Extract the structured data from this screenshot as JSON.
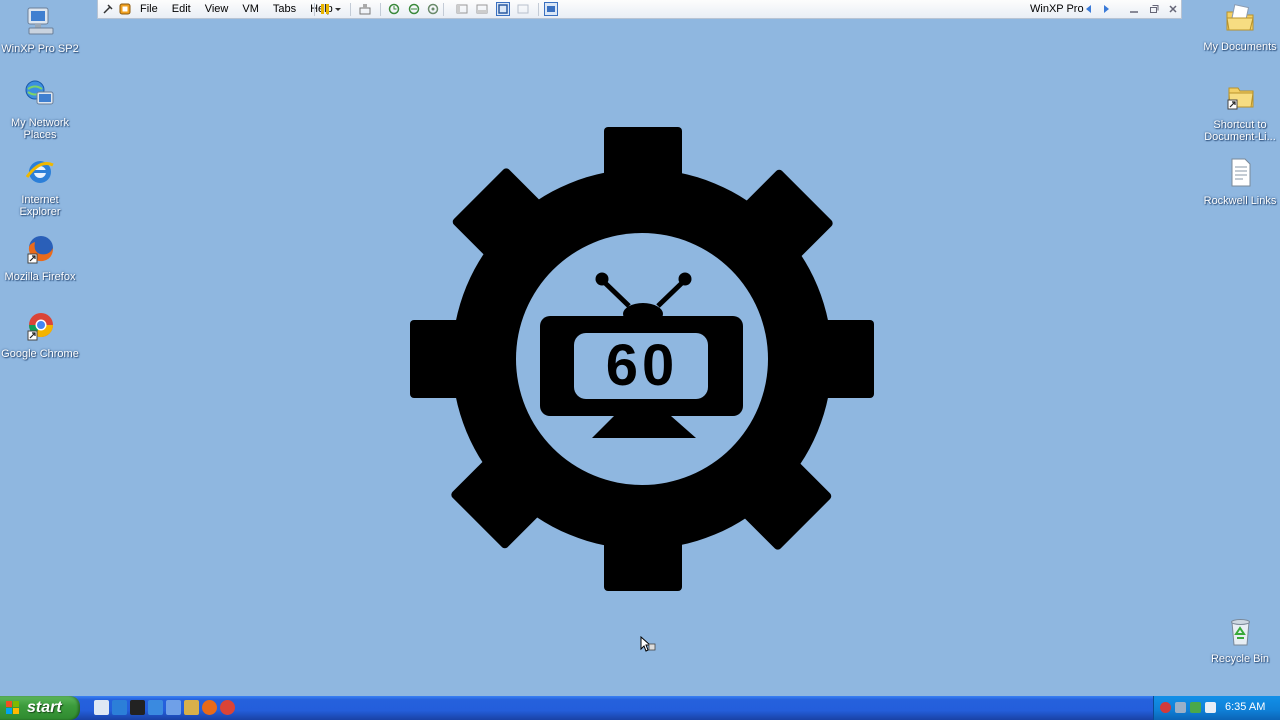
{
  "vm_toolbar": {
    "menu": [
      "File",
      "Edit",
      "View",
      "VM",
      "Tabs",
      "Help"
    ],
    "vm_name": "WinXP Pro"
  },
  "desktop": {
    "left_icons": [
      {
        "label": "WinXP Pro SP2",
        "icon": "computer-icon"
      },
      {
        "label": "My Network Places",
        "icon": "network-icon"
      },
      {
        "label": "Internet Explorer",
        "icon": "ie-icon"
      },
      {
        "label": "Mozilla Firefox",
        "icon": "firefox-icon"
      },
      {
        "label": "Google Chrome",
        "icon": "chrome-icon"
      }
    ],
    "right_icons": [
      {
        "label": "My Documents",
        "icon": "documents-folder-icon"
      },
      {
        "label": "Shortcut to Document-Li...",
        "icon": "folder-shortcut-icon"
      },
      {
        "label": "Rockwell Links",
        "icon": "text-file-icon"
      },
      {
        "label": "Recycle Bin",
        "icon": "recycle-bin-icon"
      }
    ],
    "wallpaper_logo": "gear-tv-logo",
    "logo_number": "60"
  },
  "taskbar": {
    "start_label": "start",
    "clock": "6:35 AM",
    "colors": {
      "taskbar": "#245edb",
      "start": "#3c9c3c",
      "tray": "#0f7fd6"
    }
  },
  "colors": {
    "desktop_background": "#8fb7e0",
    "logo": "#000000"
  }
}
